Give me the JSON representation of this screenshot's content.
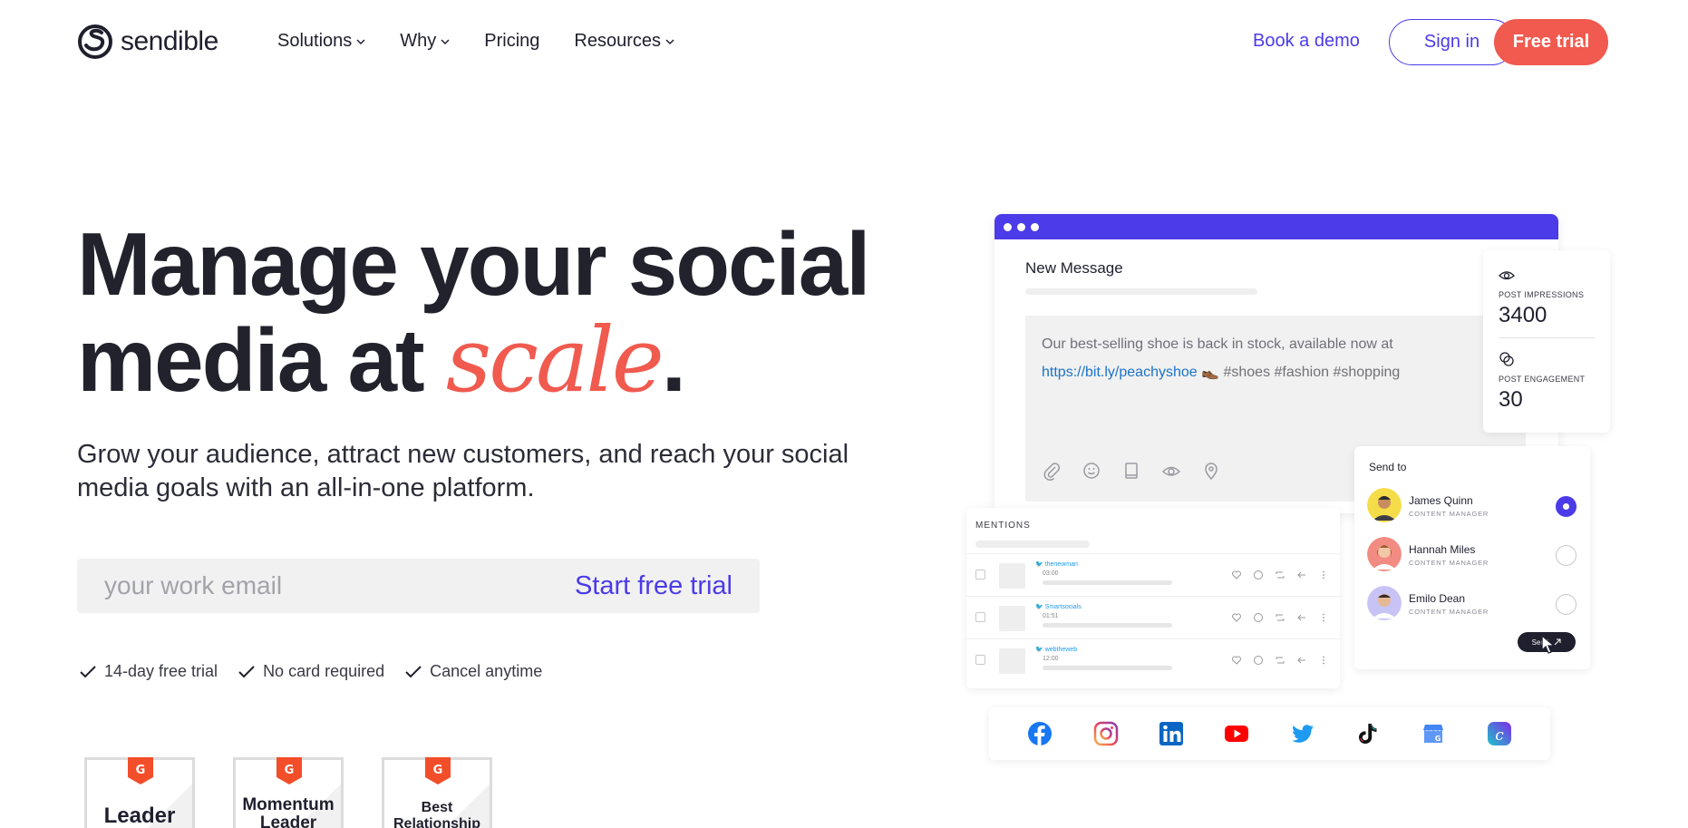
{
  "nav": {
    "brand": "sendible",
    "links": [
      {
        "label": "Solutions",
        "dropdown": true
      },
      {
        "label": "Why",
        "dropdown": true
      },
      {
        "label": "Pricing",
        "dropdown": false
      },
      {
        "label": "Resources",
        "dropdown": true
      }
    ],
    "book_demo": "Book a demo",
    "sign_in": "Sign in",
    "free_trial": "Free trial"
  },
  "hero": {
    "headline_line1": "Manage your social",
    "headline_line2_prefix": "media at ",
    "headline_accent": "scale",
    "headline_suffix": ".",
    "subhead": "Grow your audience, attract new customers, and reach your social media goals with an all-in-one platform.",
    "email_placeholder": "your work email",
    "cta": "Start free trial",
    "perks": [
      "14-day free trial",
      "No card required",
      "Cancel anytime"
    ],
    "badges": [
      {
        "line1": "Leader",
        "line2": ""
      },
      {
        "line1": "Momentum",
        "line2": "Leader"
      },
      {
        "line1": "Best",
        "line2": "Relationship"
      }
    ]
  },
  "mockup": {
    "window_title": "New Message",
    "compose": {
      "text_before": "Our best-selling shoe is back in stock, available now at",
      "link": "https://bit.ly/peachyshoe",
      "emoji": "👞",
      "hashtags": "#shoes #fashion #shopping"
    },
    "tools": [
      "paperclip-icon",
      "smile-icon",
      "book-icon",
      "eye-icon",
      "location-icon"
    ],
    "stats": [
      {
        "label": "POST IMPRESSIONS",
        "value": "3400"
      },
      {
        "label": "POST ENGAGEMENT",
        "value": "30"
      }
    ],
    "mentions": {
      "title": "MENTIONS",
      "rows": [
        {
          "user": "thenewman",
          "time": "03:00"
        },
        {
          "user": "Smartsocials",
          "time": "01:51"
        },
        {
          "user": "webtheweb",
          "time": "12:00"
        }
      ]
    },
    "send_to": {
      "title": "Send to",
      "people": [
        {
          "name": "James Quinn",
          "role": "CONTENT MANAGER",
          "selected": true,
          "avatar_color": "#f5dd4a"
        },
        {
          "name": "Hannah Miles",
          "role": "CONTENT MANAGER",
          "selected": false,
          "avatar_color": "#f28c82"
        },
        {
          "name": "Emilo Dean",
          "role": "CONTENT MANAGER",
          "selected": false,
          "avatar_color": "#c7c4f5"
        }
      ],
      "send_label": "Send"
    },
    "socials": [
      "facebook-icon",
      "instagram-icon",
      "linkedin-icon",
      "youtube-icon",
      "twitter-icon",
      "tiktok-icon",
      "google-business-icon",
      "canva-icon"
    ]
  },
  "colors": {
    "accent": "#4b3be8",
    "coral": "#f05a4f",
    "ink": "#1f1f2e"
  }
}
